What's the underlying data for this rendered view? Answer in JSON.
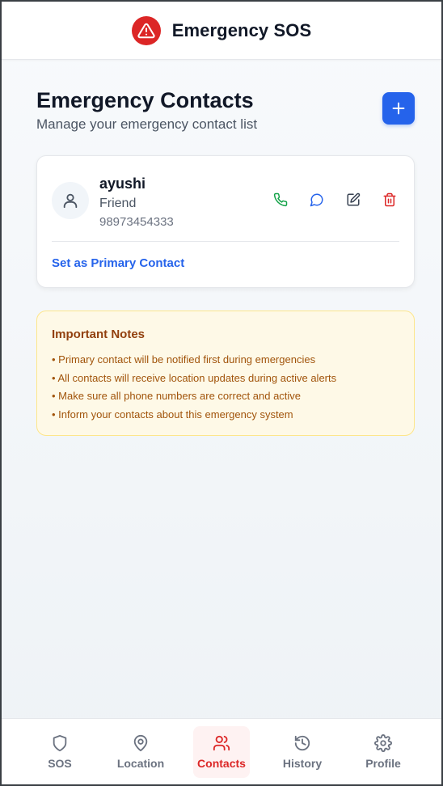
{
  "header": {
    "title": "Emergency SOS",
    "logo_icon": "alert-triangle-icon",
    "accent": "#dc2626"
  },
  "page": {
    "title": "Emergency Contacts",
    "subtitle": "Manage your emergency contact list",
    "add_icon": "plus-icon"
  },
  "contacts": [
    {
      "name": "ayushi",
      "relation": "Friend",
      "phone": "98973454333",
      "action_icons": [
        "phone-icon",
        "message-icon",
        "edit-icon",
        "trash-icon"
      ],
      "primary_link": "Set as Primary Contact"
    }
  ],
  "notes": {
    "title": "Important Notes",
    "items": [
      "• Primary contact will be notified first during emergencies",
      "• All contacts will receive location updates during active alerts",
      "• Make sure all phone numbers are correct and active",
      "• Inform your contacts about this emergency system"
    ]
  },
  "nav": {
    "items": [
      {
        "label": "SOS",
        "icon": "shield-icon",
        "active": false
      },
      {
        "label": "Location",
        "icon": "map-pin-icon",
        "active": false
      },
      {
        "label": "Contacts",
        "icon": "users-icon",
        "active": true
      },
      {
        "label": "History",
        "icon": "history-icon",
        "active": false
      },
      {
        "label": "Profile",
        "icon": "gear-icon",
        "active": false
      }
    ]
  },
  "colors": {
    "primary_blue": "#2563eb",
    "danger_red": "#dc2626",
    "call_green": "#16a34a",
    "notes_bg": "#fef9e7"
  }
}
